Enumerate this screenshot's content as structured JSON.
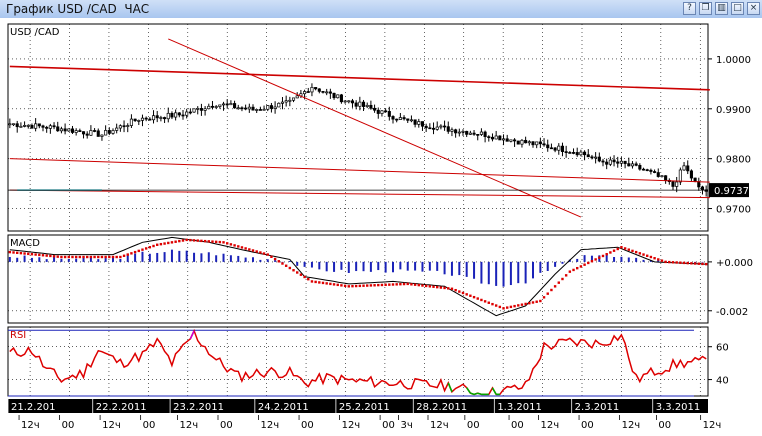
{
  "window": {
    "title": "График USD /CAD  ЧАС",
    "buttons": [
      {
        "name": "help-icon",
        "glyph": "?"
      },
      {
        "name": "restore-icon",
        "glyph": "❐"
      },
      {
        "name": "tile-icon",
        "glyph": "▥"
      },
      {
        "name": "maximize-icon",
        "glyph": "□"
      },
      {
        "name": "close-icon",
        "glyph": "×"
      }
    ]
  },
  "colors": {
    "bg": "#ffffff",
    "grid": "#000000",
    "candle": "#000000",
    "trend": "#cc0000",
    "macd_line": "#000000",
    "macd_signal": "#dd0000",
    "macd_hist": "#1a22b8",
    "rsi": "#dd0000",
    "rsi_hi": "#cc00cc",
    "rsi_lo": "#00aa00",
    "price_tag_bg": "#000000",
    "cyan": "#33ccdd",
    "axis_bar": "#000000"
  },
  "chart_data": [
    {
      "type": "candlestick",
      "title": "USD /CAD",
      "timeframe": "ЧАС",
      "ylim": [
        0.9655,
        1.007
      ],
      "y_ticks": [
        {
          "v": 1.0,
          "label": "1.0000"
        },
        {
          "v": 0.99,
          "label": "0.9900"
        },
        {
          "v": 0.98,
          "label": "0.9800"
        },
        {
          "v": 0.97,
          "label": "0.9700"
        }
      ],
      "current_price": {
        "v": 0.9737,
        "label": "0.9737"
      },
      "n_bars": 190,
      "close_anchors": [
        [
          0,
          0.987
        ],
        [
          12,
          0.9862
        ],
        [
          25,
          0.9848
        ],
        [
          35,
          0.988
        ],
        [
          46,
          0.9888
        ],
        [
          56,
          0.991
        ],
        [
          66,
          0.9898
        ],
        [
          76,
          0.9912
        ],
        [
          82,
          0.9945
        ],
        [
          88,
          0.9925
        ],
        [
          98,
          0.99
        ],
        [
          108,
          0.9875
        ],
        [
          118,
          0.986
        ],
        [
          128,
          0.985
        ],
        [
          138,
          0.9835
        ],
        [
          148,
          0.9822
        ],
        [
          155,
          0.9812
        ],
        [
          160,
          0.9795
        ],
        [
          166,
          0.979
        ],
        [
          172,
          0.9778
        ],
        [
          177,
          0.976
        ],
        [
          180,
          0.9745
        ],
        [
          183,
          0.9785
        ],
        [
          187,
          0.974
        ],
        [
          192,
          0.9728
        ]
      ],
      "trend_lines": [
        {
          "x1": 0,
          "y1": 0.9985,
          "x2": 190,
          "y2": 0.9938
        },
        {
          "x1": 0,
          "y1": 0.98,
          "x2": 190,
          "y2": 0.9753
        },
        {
          "x1": 0,
          "y1": 0.9737,
          "x2": 190,
          "y2": 0.9722
        },
        {
          "x1": 43,
          "y1": 1.004,
          "x2": 155,
          "y2": 0.9683
        }
      ],
      "cyan_segment": {
        "x1": 2,
        "x2": 25,
        "y": 0.9737
      }
    },
    {
      "type": "line",
      "title": "MACD",
      "ylim": [
        -0.0025,
        0.0011
      ],
      "y_ticks": [
        {
          "v": 0.0,
          "label": "+0.000"
        },
        {
          "v": -0.002,
          "label": "-0.002"
        }
      ],
      "macd_anchors": [
        [
          0,
          0.0005
        ],
        [
          12,
          0.0003
        ],
        [
          28,
          0.0003
        ],
        [
          36,
          0.0008
        ],
        [
          44,
          0.001
        ],
        [
          54,
          0.0008
        ],
        [
          66,
          0.0004
        ],
        [
          76,
          0.0001
        ],
        [
          80,
          -0.0006
        ],
        [
          92,
          -0.0009
        ],
        [
          104,
          -0.0008
        ],
        [
          118,
          -0.001
        ],
        [
          132,
          -0.0022
        ],
        [
          140,
          -0.0018
        ],
        [
          148,
          -0.0005
        ],
        [
          155,
          0.0005
        ],
        [
          165,
          0.0006
        ],
        [
          175,
          0.0
        ],
        [
          190,
          -0.0001
        ]
      ],
      "signal_anchors": [
        [
          0,
          0.0004
        ],
        [
          14,
          0.0002
        ],
        [
          30,
          0.0002
        ],
        [
          40,
          0.0007
        ],
        [
          48,
          0.0009
        ],
        [
          58,
          0.0008
        ],
        [
          70,
          0.0003
        ],
        [
          82,
          -0.0008
        ],
        [
          92,
          -0.001
        ],
        [
          108,
          -0.0009
        ],
        [
          120,
          -0.0011
        ],
        [
          134,
          -0.0019
        ],
        [
          144,
          -0.0016
        ],
        [
          152,
          -0.0004
        ],
        [
          166,
          0.0006
        ],
        [
          178,
          0.0
        ],
        [
          190,
          -0.0001
        ]
      ]
    },
    {
      "type": "line",
      "title": "RSI",
      "ylim": [
        30,
        72
      ],
      "y_ticks": [
        {
          "v": 60,
          "label": "60"
        },
        {
          "v": 40,
          "label": "40"
        }
      ],
      "levels": [
        {
          "v": 70
        },
        {
          "v": 30
        }
      ],
      "rsi_anchors": [
        [
          0,
          56
        ],
        [
          6,
          58
        ],
        [
          10,
          46
        ],
        [
          14,
          40
        ],
        [
          20,
          44
        ],
        [
          24,
          58
        ],
        [
          30,
          50
        ],
        [
          36,
          55
        ],
        [
          40,
          63
        ],
        [
          44,
          50
        ],
        [
          50,
          68
        ],
        [
          56,
          52
        ],
        [
          62,
          42
        ],
        [
          70,
          45
        ],
        [
          76,
          44
        ],
        [
          80,
          38
        ],
        [
          86,
          41
        ],
        [
          94,
          39
        ],
        [
          104,
          38
        ],
        [
          112,
          37
        ],
        [
          120,
          36
        ],
        [
          128,
          31
        ],
        [
          136,
          34
        ],
        [
          140,
          36
        ],
        [
          145,
          60
        ],
        [
          152,
          63
        ],
        [
          160,
          62
        ],
        [
          166,
          67
        ],
        [
          170,
          40
        ],
        [
          176,
          46
        ],
        [
          182,
          50
        ],
        [
          190,
          51
        ]
      ]
    }
  ],
  "time_axis": {
    "date_labels": [
      {
        "bar": 0,
        "label": "21.2.201"
      },
      {
        "bar": 23,
        "label": "22.2.2011"
      },
      {
        "bar": 44,
        "label": "23.2.2011"
      },
      {
        "bar": 67,
        "label": "24.2.2011"
      },
      {
        "bar": 89,
        "label": "25.2.2011"
      },
      {
        "bar": 110,
        "label": "28.2.2011"
      },
      {
        "bar": 132,
        "label": "1.3.2011"
      },
      {
        "bar": 153,
        "label": "2.3.2011"
      },
      {
        "bar": 175,
        "label": "3.3.2011"
      }
    ],
    "hour_labels": [
      {
        "bar": 3,
        "label": "12ч"
      },
      {
        "bar": 14,
        "label": "00"
      },
      {
        "bar": 25,
        "label": "12ч"
      },
      {
        "bar": 36,
        "label": "00"
      },
      {
        "bar": 46,
        "label": "12ч"
      },
      {
        "bar": 57,
        "label": "00"
      },
      {
        "bar": 68,
        "label": "12ч"
      },
      {
        "bar": 79,
        "label": "00"
      },
      {
        "bar": 90,
        "label": "12ч"
      },
      {
        "bar": 101,
        "label": "00"
      },
      {
        "bar": 106,
        "label": "3ч"
      },
      {
        "bar": 114,
        "label": "12ч"
      },
      {
        "bar": 124,
        "label": "00"
      },
      {
        "bar": 136,
        "label": "00"
      },
      {
        "bar": 144,
        "label": "12ч"
      },
      {
        "bar": 155,
        "label": "00"
      },
      {
        "bar": 166,
        "label": "12ч"
      },
      {
        "bar": 176,
        "label": "00"
      },
      {
        "bar": 188,
        "label": "12ч"
      }
    ]
  }
}
